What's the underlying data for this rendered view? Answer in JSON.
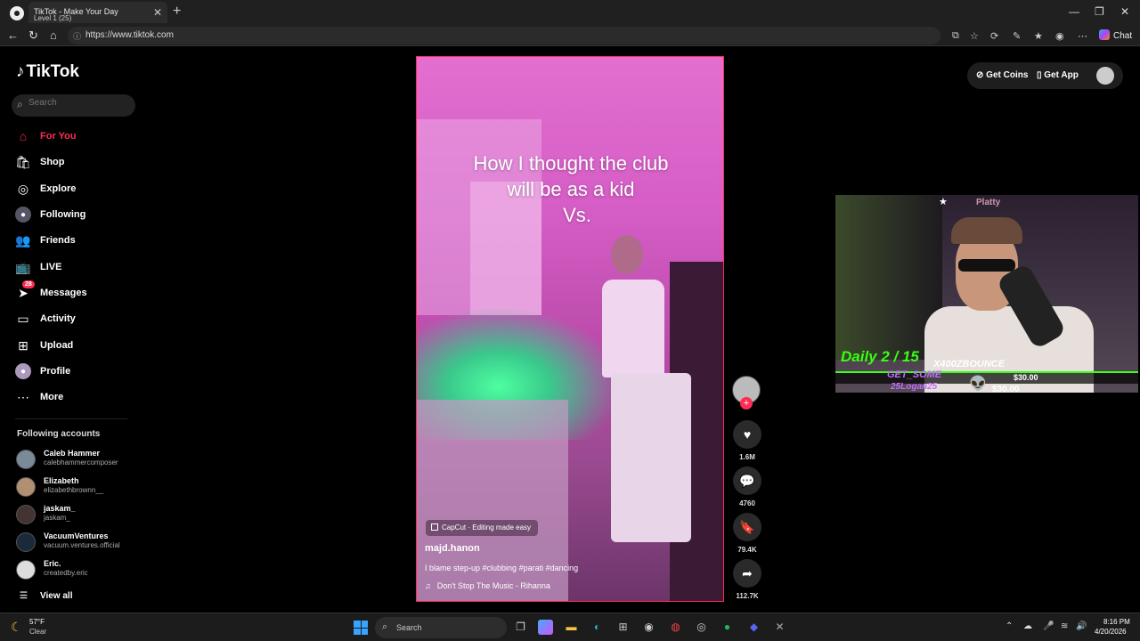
{
  "browser": {
    "tab_title": "TikTok - Make Your Day",
    "tab_overlay_text": "Level 1  (25)",
    "url": "https://www.tiktok.com",
    "chat_label": "Chat"
  },
  "tiktok": {
    "logo_text": "TikTok",
    "search_placeholder": "Search",
    "nav": [
      {
        "label": "For You",
        "icon": "home-icon",
        "active": true
      },
      {
        "label": "Shop",
        "icon": "shop-bag-icon"
      },
      {
        "label": "Explore",
        "icon": "compass-icon"
      },
      {
        "label": "Following",
        "icon": "following-avatar-icon"
      },
      {
        "label": "Friends",
        "icon": "friends-icon"
      },
      {
        "label": "LIVE",
        "icon": "live-tv-icon"
      },
      {
        "label": "Messages",
        "icon": "messages-icon",
        "badge": "28"
      },
      {
        "label": "Activity",
        "icon": "activity-icon"
      },
      {
        "label": "Upload",
        "icon": "upload-icon"
      },
      {
        "label": "Profile",
        "icon": "profile-avatar-icon"
      },
      {
        "label": "More",
        "icon": "more-dots-icon"
      }
    ],
    "following_header": "Following accounts",
    "accounts": [
      {
        "name": "Caleb Hammer",
        "handle": "calebhammercomposer"
      },
      {
        "name": "Elizabeth",
        "handle": "elizabethbrownn__"
      },
      {
        "name": "jaskam_",
        "handle": "jaskam_"
      },
      {
        "name": "VacuumVentures",
        "handle": "vacuum.ventures.official"
      },
      {
        "name": "Eric.",
        "handle": "createdby.eric"
      }
    ],
    "view_all": "View all",
    "get_coins": "Get Coins",
    "get_app": "Get App"
  },
  "video": {
    "overlay_line1": "How I thought the club",
    "overlay_line2": "will be as a kid",
    "overlay_line3": "Vs.",
    "capcut_label": "CapCut · Editing made easy",
    "author": "majd.hanon",
    "description": "I blame step-up #clubbing #parati #dancing",
    "music": "Don't Stop The Music - Rihanna",
    "likes": "1.6M",
    "comments": "4760",
    "saves": "79.4K",
    "shares": "112.7K"
  },
  "stream_overlay": {
    "top_name": "Platty",
    "daily_goal": "Daily 2 / 15",
    "subscriber": "X400ZBOUNCE",
    "event_label": "GET_SOME",
    "amount1": "$30.00",
    "donor": "25Logan25",
    "amount2": "$30.00"
  },
  "taskbar": {
    "temp": "57°F",
    "condition": "Clear",
    "search": "Search",
    "time": "8:16 PM",
    "date": "4/20/2026"
  },
  "colors": {
    "accent": "#fe2c55",
    "overlay_green": "#39ff14",
    "overlay_purple": "#c36cff"
  }
}
